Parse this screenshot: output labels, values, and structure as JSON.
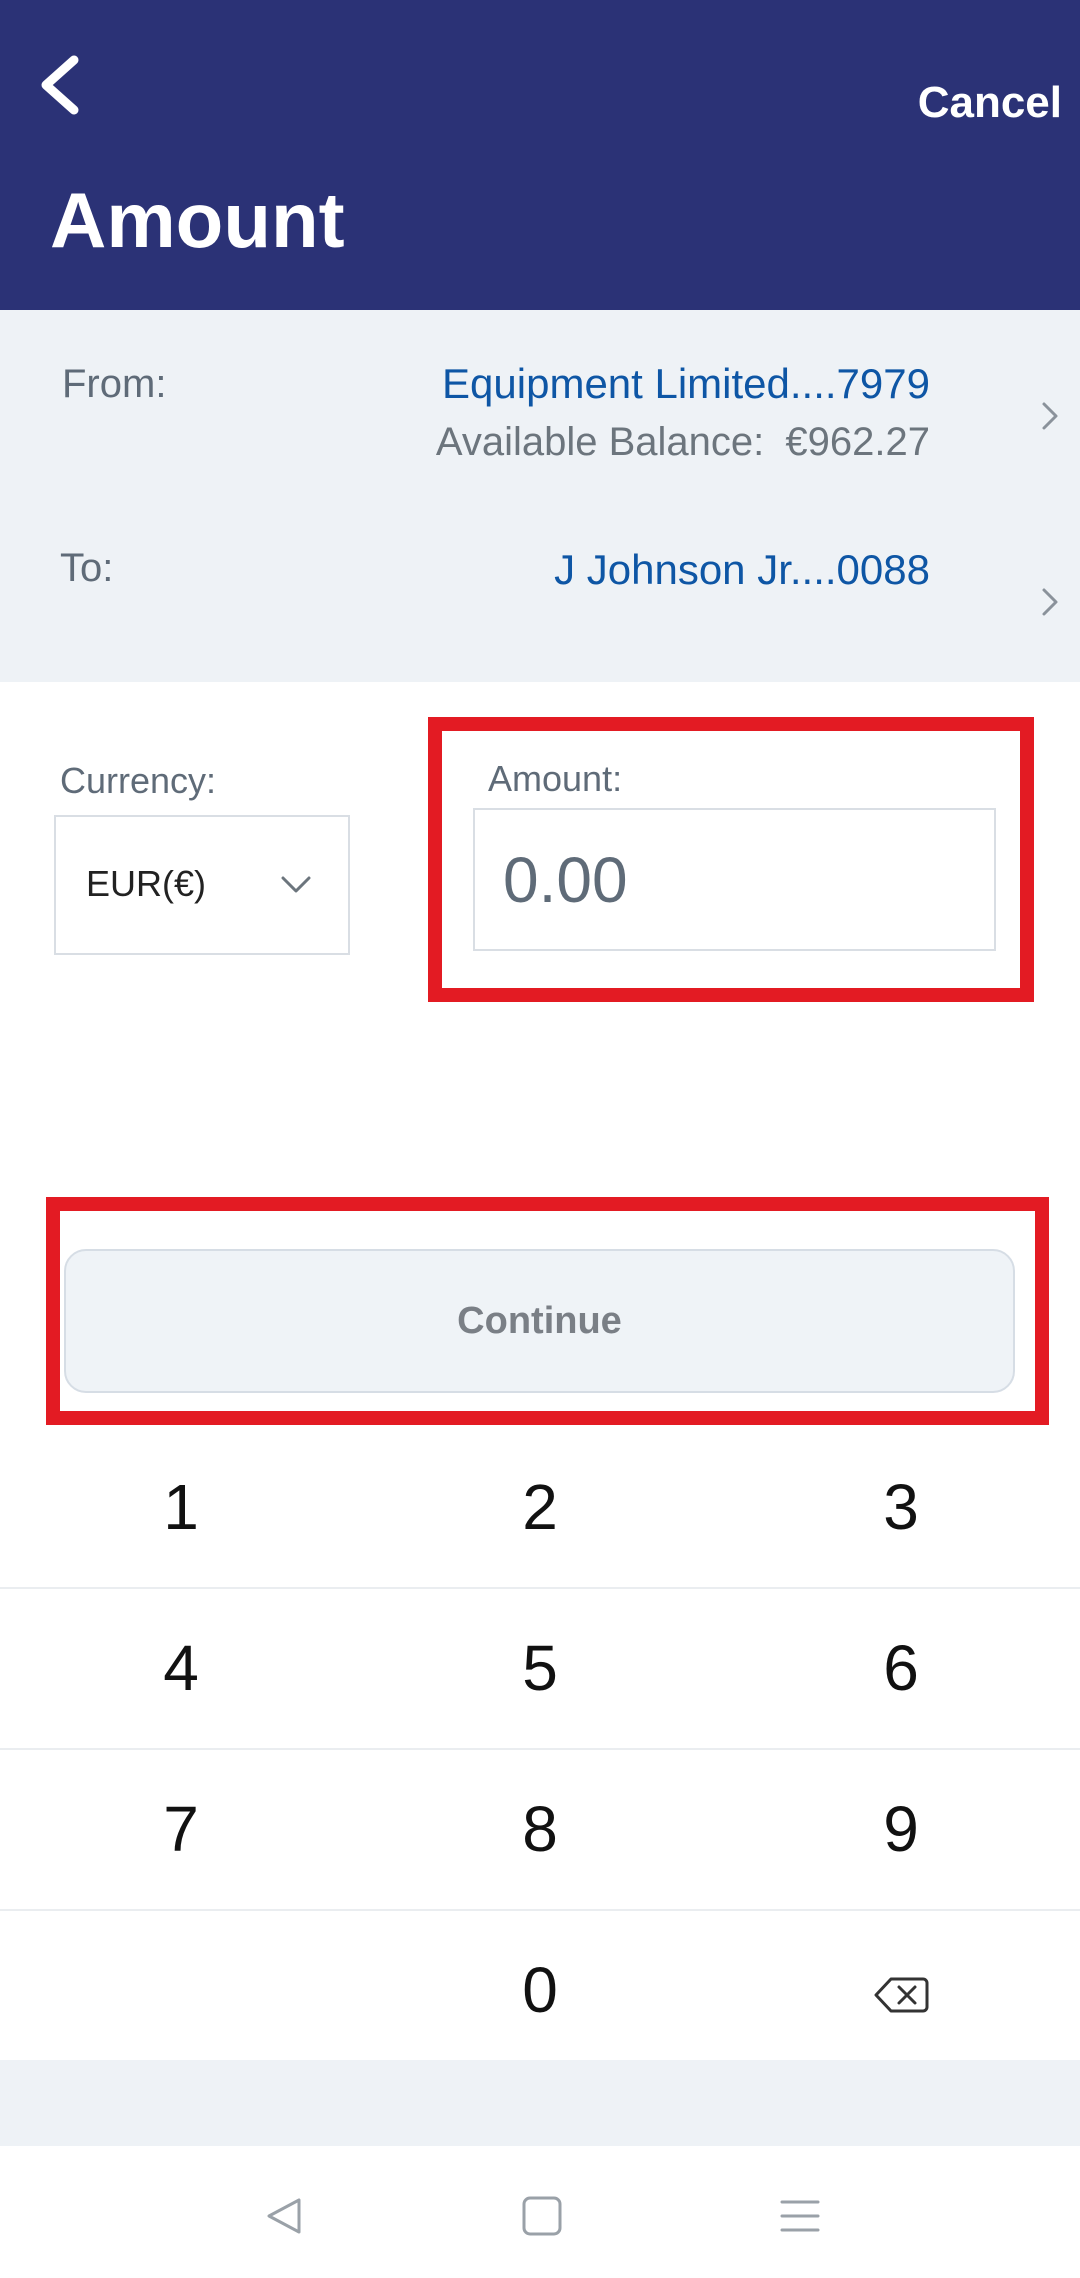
{
  "header": {
    "title": "Amount",
    "cancel_label": "Cancel",
    "background": "#2b3276"
  },
  "accounts": {
    "from": {
      "label": "From:",
      "name": "Equipment Limited....7979",
      "balance_label": "Available Balance:",
      "balance_value": "€962.27"
    },
    "to": {
      "label": "To:",
      "name": "J Johnson Jr....0088"
    }
  },
  "currency": {
    "label": "Currency:",
    "selected": "EUR(€)"
  },
  "amount": {
    "label": "Amount:",
    "placeholder": "0.00",
    "value": ""
  },
  "continue_label": "Continue",
  "keypad": {
    "rows": [
      [
        "1",
        "2",
        "3"
      ],
      [
        "4",
        "5",
        "6"
      ],
      [
        "7",
        "8",
        "9"
      ],
      [
        "",
        "0",
        "backspace-icon"
      ]
    ]
  },
  "nav": [
    "back-icon",
    "home-icon",
    "menu-icon"
  ],
  "colors": {
    "accent_link": "#0e56a5",
    "highlight": "#e31b23"
  }
}
